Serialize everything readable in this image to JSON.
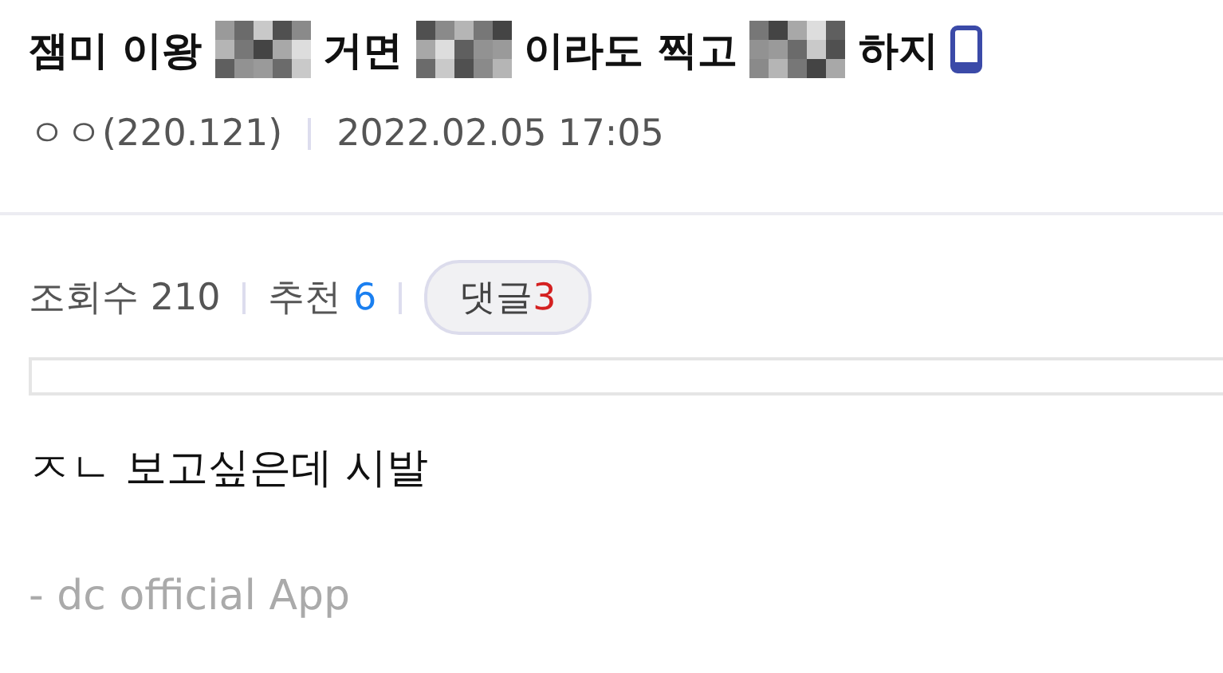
{
  "title": [
    {
      "kind": "text",
      "text": "잼미 이왕"
    },
    {
      "kind": "mosaic"
    },
    {
      "kind": "text",
      "text": "거면"
    },
    {
      "kind": "mosaic"
    },
    {
      "kind": "text",
      "text": "이라도 찍고"
    },
    {
      "kind": "mosaic"
    },
    {
      "kind": "text",
      "text": "하지"
    }
  ],
  "mobile_post": true,
  "author": "ㅇㅇ(220.121)",
  "date": "2022.02.05 17:05",
  "views": {
    "label": "조회수",
    "value": "210"
  },
  "recommend": {
    "label": "추천",
    "value": "6"
  },
  "comments": {
    "label": "댓글",
    "value": "3"
  },
  "body": "ㅈㄴ 보고싶은데 시발",
  "signature": "- dc official App"
}
